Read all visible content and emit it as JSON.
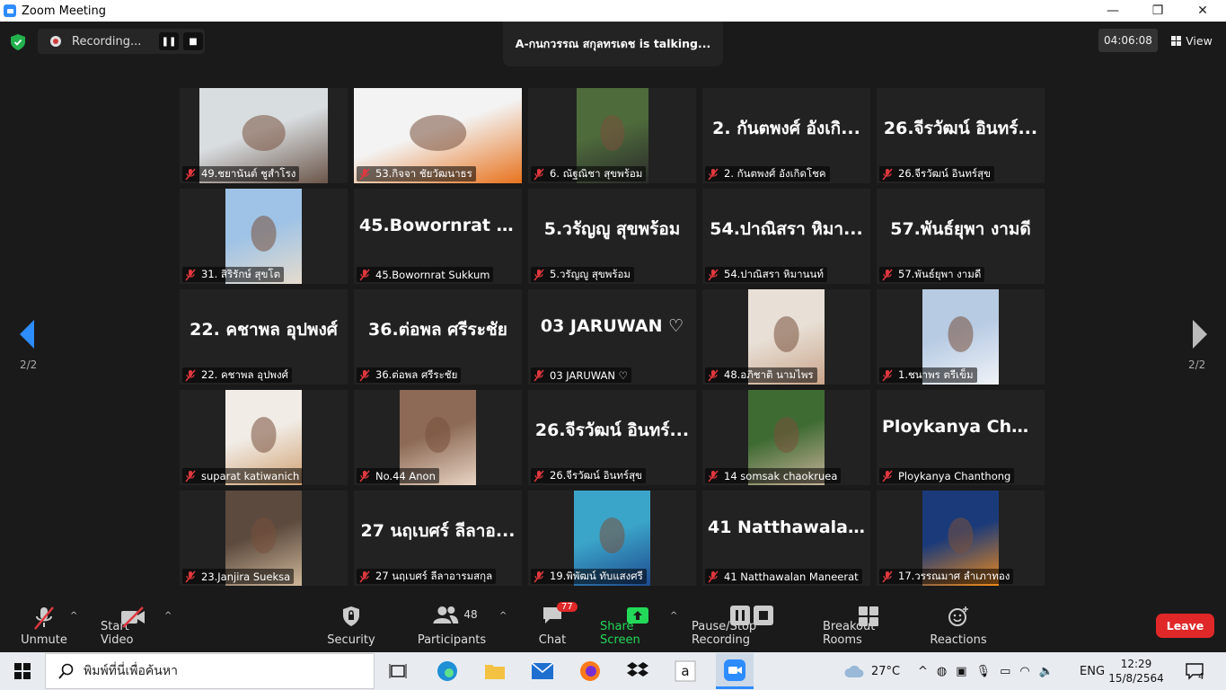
{
  "window": {
    "title": "Zoom Meeting",
    "minimize": "—",
    "restore": "❐",
    "close": "✕"
  },
  "meeting": {
    "recording_label": "Recording...",
    "talking_banner": "A-กนกวรรณ สกุลทรเดช is talking...",
    "timer": "04:06:08",
    "view_label": "View",
    "page_left": "2/2",
    "page_right": "2/2"
  },
  "participants": [
    {
      "label": "49.ชยานันต์ ชูสำโรง",
      "video": true
    },
    {
      "label": "53.กิจจา ชัยวัฒนาธร",
      "video": true
    },
    {
      "label": "6. ณัฐณิชา สุขพร้อม",
      "video": true
    },
    {
      "label": "2. กันตพงศ์ อังเกิดโชค",
      "bigname": "2. กันตพงศ์ อังเกิ...",
      "video": false
    },
    {
      "label": "26.จีรวัฒน์ อินทร์สุข",
      "bigname": "26.จีรวัฒน์ อินทร์...",
      "video": false
    },
    {
      "label": "31. สิริรักษ์ สุขโต",
      "video": true
    },
    {
      "label": "45.Bowornrat Sukkum",
      "bigname": "45.Bowornrat  S...",
      "video": false
    },
    {
      "label": "5.วรัญญู สุขพร้อม",
      "bigname": "5.วรัญญู สุขพร้อม",
      "video": false
    },
    {
      "label": "54.ปาณิสรา หิมานนท์",
      "bigname": "54.ปาณิสรา หิมา...",
      "video": false
    },
    {
      "label": "57.พันธ์ยุพา งามดี",
      "bigname": "57.พันธ์ยุพา งามดี",
      "video": false
    },
    {
      "label": "22. คชาพล อุปพงศ์",
      "bigname": "22. คชาพล อุปพงศ์",
      "video": false
    },
    {
      "label": "36.ต่อพล ศรีระชัย",
      "bigname": "36.ต่อพล ศรีระชัย",
      "video": false
    },
    {
      "label": "03 JARUWAN ♡",
      "bigname": "03 JARUWAN ♡",
      "video": false
    },
    {
      "label": "48.อภิชาติ นามไพร",
      "video": true
    },
    {
      "label": "1.ชนาพร  ตรีเข็ม",
      "video": true
    },
    {
      "label": "suparat katiwanich",
      "video": true
    },
    {
      "label": "No.44 Anon",
      "video": true
    },
    {
      "label": "26.จีรวัฒน์ อินทร์สุข",
      "bigname": "26.จีรวัฒน์ อินทร์...",
      "video": false
    },
    {
      "label": "14 somsak chaokruea",
      "video": true
    },
    {
      "label": "Ploykanya Chanthong",
      "bigname": "Ploykanya  Chan...",
      "video": false
    },
    {
      "label": "23.Janjira Sueksa",
      "video": true
    },
    {
      "label": "27 นฤเบศร์ ลีลาอารมสกุล",
      "bigname": "27 นฤเบศร์ ลีลาอ...",
      "video": false
    },
    {
      "label": "19.พิพัฒน์ ทับแสงศรี",
      "video": true
    },
    {
      "label": "41 Natthawalan Maneerat",
      "bigname": "41  Natthawalan...",
      "video": false
    },
    {
      "label": "17.วรรณมาศ ลำเภาทอง",
      "video": true
    }
  ],
  "toolbar": {
    "unmute": "Unmute",
    "start_video": "Start Video",
    "security": "Security",
    "participants": "Participants",
    "participants_count": "48",
    "chat": "Chat",
    "chat_badge": "77",
    "share_screen": "Share Screen",
    "pause_stop": "Pause/Stop Recording",
    "breakout": "Breakout Rooms",
    "reactions": "Reactions",
    "leave": "Leave"
  },
  "taskbar": {
    "search_placeholder": "พิมพ์ที่นี่เพื่อค้นหา",
    "temperature": "27°C",
    "language": "ENG",
    "time": "12:29",
    "date": "15/8/2564",
    "notification_count": "4"
  },
  "colors": {
    "accent": "#2d8cff",
    "leave": "#e02828",
    "share": "#23d959",
    "mic_muted": "#e0383e"
  }
}
